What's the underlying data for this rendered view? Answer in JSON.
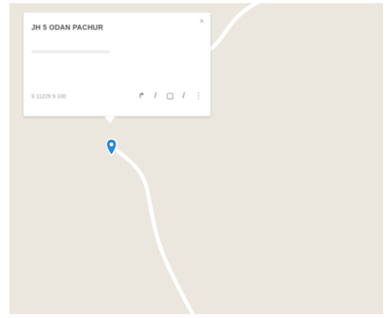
{
  "place_card": {
    "title": "JH 5 ODAN PACHUR",
    "phone": "9 11226 9 100",
    "close_glyph": "×",
    "actions": [
      {
        "name": "directions-icon",
        "glyph": "↱"
      },
      {
        "name": "edit-icon",
        "glyph": "/"
      },
      {
        "name": "save-icon",
        "glyph": "▢"
      },
      {
        "name": "share-icon",
        "glyph": "/"
      },
      {
        "name": "more-icon",
        "glyph": "⋮"
      }
    ]
  },
  "colors": {
    "map_background": "#ebe7de",
    "road": "#ffffff",
    "pin": "#2a88d8"
  }
}
